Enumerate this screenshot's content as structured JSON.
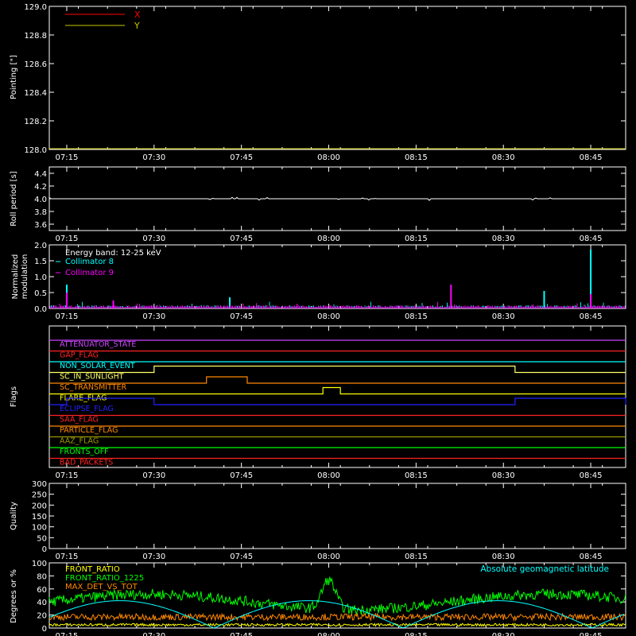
{
  "x_ticks": [
    "07:15",
    "07:30",
    "07:45",
    "08:00",
    "08:15",
    "08:30",
    "08:45"
  ],
  "colors": {
    "bg": "#000000",
    "fg": "#ffffff",
    "red": "#ff0000",
    "yellow": "#ffff00",
    "cyan": "#00ffff",
    "magenta": "#ff00ff",
    "orange": "#ff8800",
    "green": "#00ff00",
    "blue": "#0000ff",
    "olive": "#a0a000",
    "purple": "#cc44ff"
  },
  "chart_data": [
    {
      "type": "line",
      "ylabel": "Pointing [\"]",
      "ylim": [
        128.0,
        129.0
      ],
      "yticks": [
        "128.0",
        "128.2",
        "128.4",
        "128.6",
        "128.8",
        "129.0"
      ],
      "series": [
        {
          "name": "X",
          "color": "#ff0000",
          "values": []
        },
        {
          "name": "Y",
          "color": "#c8c800",
          "values": []
        }
      ]
    },
    {
      "type": "line",
      "ylabel": "Roll period [s]",
      "ylim": [
        3.5,
        4.5
      ],
      "yticks": [
        "3.6",
        "3.8",
        "4.0",
        "4.2",
        "4.4"
      ],
      "series": [
        {
          "color": "#ffffff",
          "baseline": 4.0
        }
      ]
    },
    {
      "type": "line",
      "ylabel": "Normalized modulation",
      "ylim": [
        0.0,
        2.0
      ],
      "yticks": [
        "0.0",
        "0.5",
        "1.0",
        "1.5",
        "2.0"
      ],
      "annotation": "Energy band: 12-25 keV",
      "series": [
        {
          "name": "Collimator 8",
          "color": "#00ffff",
          "spikes": [
            [
              "07:15",
              0.75
            ],
            [
              "07:43",
              0.35
            ],
            [
              "08:37",
              0.55
            ],
            [
              "08:45",
              1.85
            ]
          ]
        },
        {
          "name": "Collimator 9",
          "color": "#ff00ff",
          "spikes": [
            [
              "07:15",
              0.5
            ],
            [
              "07:23",
              0.25
            ],
            [
              "08:21",
              0.75
            ],
            [
              "08:45",
              0.45
            ]
          ]
        }
      ]
    },
    {
      "type": "line",
      "ylabel": "Flags",
      "flags": [
        {
          "name": "ATTENUATOR_STATE",
          "color": "#cc44ff"
        },
        {
          "name": "GAP_FLAG",
          "color": "#ff2222"
        },
        {
          "name": "NON_SOLAR_EVENT",
          "color": "#00ffff"
        },
        {
          "name": "SC_IN_SUNLIGHT",
          "color": "#ffff66",
          "high": [
            [
              "07:30",
              "08:32"
            ]
          ]
        },
        {
          "name": "SC_TRANSMITTER",
          "color": "#ff8800",
          "high": [
            [
              "07:39",
              "07:46"
            ]
          ]
        },
        {
          "name": "FLARE_FLAG",
          "color": "#ffff00",
          "high": [
            [
              "07:59",
              "08:02"
            ]
          ]
        },
        {
          "name": "ECLIPSE_FLAG",
          "color": "#2222ff",
          "high": [
            [
              "07:15",
              "07:30"
            ],
            [
              "08:32",
              "08:52"
            ]
          ]
        },
        {
          "name": "SAA_FLAG",
          "color": "#ff2222"
        },
        {
          "name": "PARTICLE_FLAG",
          "color": "#ff8800"
        },
        {
          "name": "AAZ_FLAG",
          "color": "#999900"
        },
        {
          "name": "FRONTS_OFF",
          "color": "#00ff00"
        },
        {
          "name": "BAD_PACKETS",
          "color": "#ff2222"
        }
      ]
    },
    {
      "type": "line",
      "ylabel": "Quality",
      "ylim": [
        0,
        300
      ],
      "yticks": [
        "0",
        "50",
        "100",
        "150",
        "200",
        "250",
        "300"
      ],
      "series": []
    },
    {
      "type": "line",
      "ylabel": "Degrees or %",
      "ylim": [
        0,
        100
      ],
      "yticks": [
        "0",
        "20",
        "40",
        "60",
        "80",
        "100"
      ],
      "annotation": "Absolute geomagnetic latitude",
      "series": [
        {
          "name": "FRONT_RATIO",
          "color": "#ffff00",
          "level": 5
        },
        {
          "name": "FRONT_RATIO_1225",
          "color": "#00ff00",
          "level": 45,
          "peak": [
            "08:00",
            85
          ]
        },
        {
          "name": "MAX_DET_VS_TOT",
          "color": "#ff8800",
          "level": 17
        }
      ]
    }
  ]
}
